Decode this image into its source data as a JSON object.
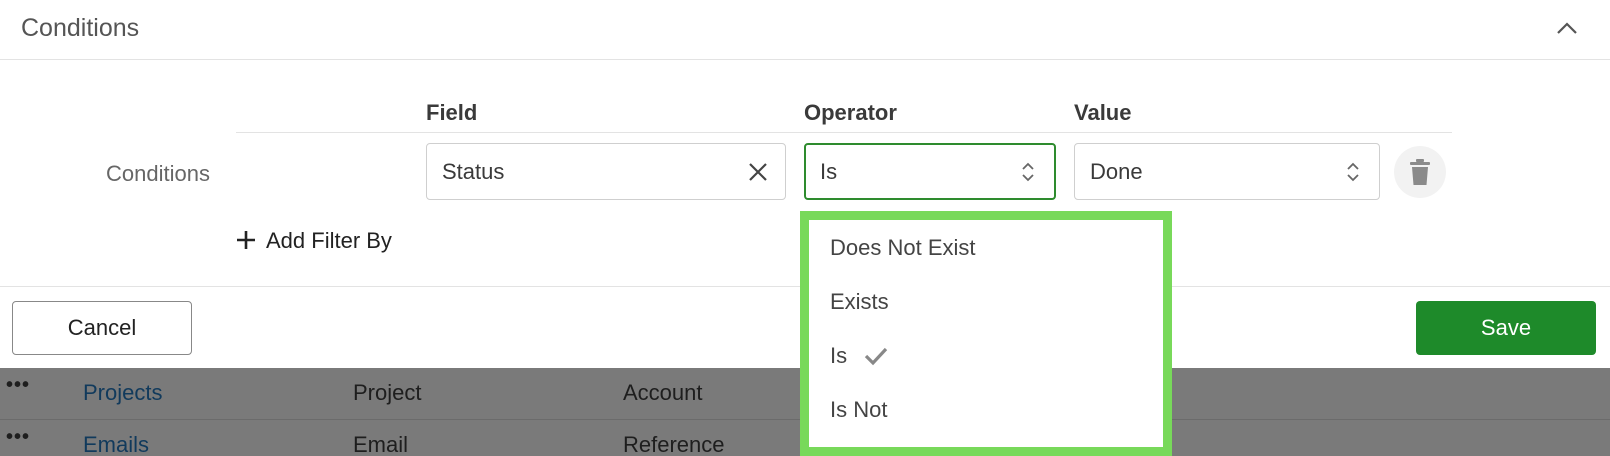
{
  "panel": {
    "title": "Conditions"
  },
  "conditions": {
    "label": "Conditions",
    "columns": {
      "field": "Field",
      "operator": "Operator",
      "value": "Value"
    },
    "row": {
      "field": "Status",
      "operator": "Is",
      "value": "Done"
    },
    "add_filter_label": "Add Filter By"
  },
  "operator_menu": {
    "options": [
      {
        "label": "Does Not Exist",
        "selected": false
      },
      {
        "label": "Exists",
        "selected": false
      },
      {
        "label": "Is",
        "selected": true
      },
      {
        "label": "Is Not",
        "selected": false
      }
    ]
  },
  "footer": {
    "cancel_label": "Cancel",
    "save_label": "Save"
  },
  "background_list": {
    "rows": [
      {
        "dots": "•••",
        "name": "Projects",
        "col2": "Project",
        "col3": "Account"
      },
      {
        "dots": "•••",
        "name": "Emails",
        "col2": "Email",
        "col3": "Reference"
      }
    ]
  },
  "colors": {
    "save": "#1e8a2a",
    "highlight": "#78d95a",
    "active_border": "#2e8b2e"
  }
}
